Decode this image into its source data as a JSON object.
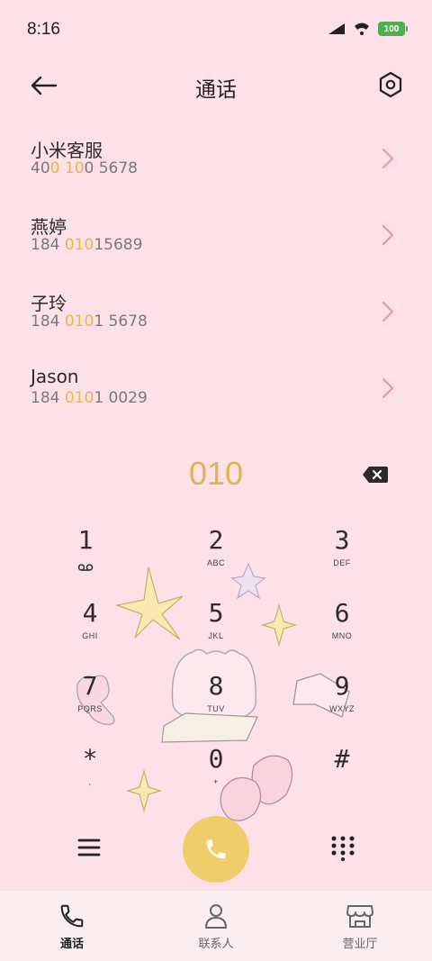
{
  "status_bar": {
    "time": "8:16",
    "battery": "100"
  },
  "header": {
    "title": "通话"
  },
  "results": [
    {
      "name": "小米客服",
      "number_parts": [
        [
          "40",
          false
        ],
        [
          "0",
          true
        ],
        [
          " ",
          false
        ],
        [
          "10",
          true
        ],
        [
          "0 5678",
          false
        ]
      ]
    },
    {
      "name": "燕婷",
      "number_parts": [
        [
          "184 ",
          false
        ],
        [
          "010",
          true
        ],
        [
          "15689",
          false
        ]
      ]
    },
    {
      "name": "子玲",
      "number_parts": [
        [
          "184 ",
          false
        ],
        [
          "010",
          true
        ],
        [
          "1 5678",
          false
        ]
      ]
    },
    {
      "name": "Jason",
      "number_parts": [
        [
          "184 ",
          false
        ],
        [
          "010",
          true
        ],
        [
          "1 0029",
          false
        ]
      ]
    }
  ],
  "dial": {
    "input": "010"
  },
  "keypad": [
    {
      "digit": "1",
      "letters": ""
    },
    {
      "digit": "2",
      "letters": "ABC"
    },
    {
      "digit": "3",
      "letters": "DEF"
    },
    {
      "digit": "4",
      "letters": "GHI"
    },
    {
      "digit": "5",
      "letters": "JKL"
    },
    {
      "digit": "6",
      "letters": "MNO"
    },
    {
      "digit": "7",
      "letters": "PQRS"
    },
    {
      "digit": "8",
      "letters": "TUV"
    },
    {
      "digit": "9",
      "letters": "WXYZ"
    },
    {
      "digit": "*",
      "letters": ","
    },
    {
      "digit": "0",
      "letters": "+"
    },
    {
      "digit": "#",
      "letters": ""
    }
  ],
  "bottom_nav": [
    {
      "label": "通话",
      "icon": "phone-icon",
      "active": true
    },
    {
      "label": "联系人",
      "icon": "person-icon",
      "active": false
    },
    {
      "label": "营业厅",
      "icon": "store-icon",
      "active": false
    }
  ],
  "colors": {
    "background": "#fde0e8",
    "accent": "#efce6a",
    "highlight": "#e8b64a",
    "arrow": "#e79aa3"
  }
}
